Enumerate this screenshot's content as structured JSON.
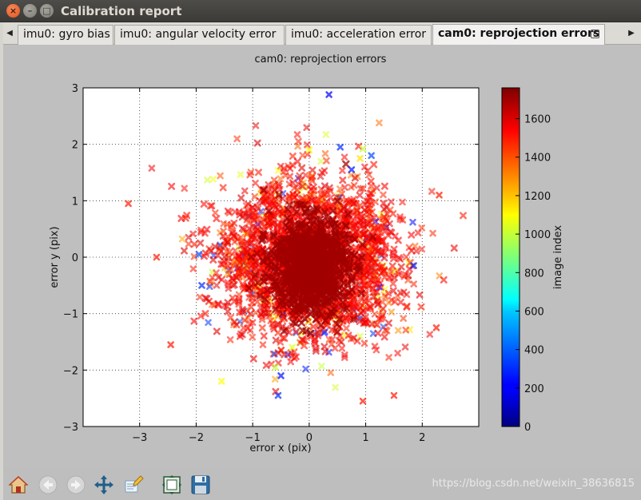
{
  "window": {
    "title": "Calibration report"
  },
  "tabs": [
    {
      "label": "imu0: gyro bias",
      "active": false
    },
    {
      "label": "imu0: angular velocity error",
      "active": false
    },
    {
      "label": "imu0: acceleration error",
      "active": false
    },
    {
      "label": "cam0: reprojection errors",
      "active": true
    }
  ],
  "toolbar": {
    "icons": [
      "home-icon",
      "back-arrow-icon",
      "forward-arrow-icon",
      "pan-icon",
      "zoom-to-rect-icon",
      "subplots-icon",
      "save-icon"
    ]
  },
  "watermark": "https://blog.csdn.net/weixin_38636815",
  "chart_data": {
    "type": "scatter",
    "title": "cam0: reprojection errors",
    "xlabel": "error x (pix)",
    "ylabel": "error y (pix)",
    "xlim": [
      -4,
      3
    ],
    "ylim": [
      -3,
      3
    ],
    "xticks": [
      "−3",
      "−2",
      "−1",
      "0",
      "1",
      "2"
    ],
    "xtick_values": [
      -3,
      -2,
      -1,
      0,
      1,
      2
    ],
    "yticks": [
      "3",
      "2",
      "1",
      "0",
      "−1",
      "−2",
      "−3"
    ],
    "ytick_values": [
      3,
      2,
      1,
      0,
      -1,
      -2,
      -3
    ],
    "grid": true,
    "marker": "x",
    "colormap": "jet",
    "colorbar": {
      "label": "image index",
      "range": [
        0,
        1760
      ],
      "ticks": [
        "0",
        "200",
        "400",
        "600",
        "800",
        "1000",
        "1200",
        "1400",
        "1600"
      ],
      "tick_values": [
        0,
        200,
        400,
        600,
        800,
        1000,
        1200,
        1400,
        1600
      ]
    },
    "cloud": {
      "center": [
        0.0,
        -0.05
      ],
      "dense_core": {
        "x_range": [
          -0.8,
          0.8
        ],
        "y_range": [
          -1.1,
          0.8
        ]
      },
      "extent": {
        "x_range": [
          -3.2,
          2.4
        ],
        "y_range": [
          -2.6,
          2.9
        ]
      },
      "dominant_index": 1700
    },
    "sample_points": [
      {
        "x": -3.2,
        "y": 0.95,
        "index": 1500
      },
      {
        "x": 0.35,
        "y": 2.88,
        "index": 200
      },
      {
        "x": -0.55,
        "y": -2.45,
        "index": 300
      },
      {
        "x": 0.95,
        "y": -2.55,
        "index": 1500
      },
      {
        "x": -2.45,
        "y": -1.55,
        "index": 1500
      },
      {
        "x": -2.7,
        "y": 0.0,
        "index": 1500
      },
      {
        "x": 1.5,
        "y": -2.45,
        "index": 1500
      },
      {
        "x": 2.3,
        "y": 1.1,
        "index": 1500
      },
      {
        "x": 2.25,
        "y": -1.25,
        "index": 1500
      },
      {
        "x": -1.55,
        "y": -2.2,
        "index": 1100
      },
      {
        "x": -0.3,
        "y": -1.6,
        "index": 1050
      },
      {
        "x": -0.6,
        "y": -1.95,
        "index": 1000
      },
      {
        "x": 0.95,
        "y": 1.92,
        "index": 1000
      },
      {
        "x": 0.55,
        "y": 1.95,
        "index": 300
      },
      {
        "x": 0.75,
        "y": 1.55,
        "index": 250
      },
      {
        "x": -0.5,
        "y": -2.1,
        "index": 250
      },
      {
        "x": -1.9,
        "y": -0.5,
        "index": 300
      },
      {
        "x": -1.95,
        "y": 0.05,
        "index": 350
      },
      {
        "x": 1.1,
        "y": 1.8,
        "index": 350
      },
      {
        "x": 1.85,
        "y": -0.15,
        "index": 300
      },
      {
        "x": 0.9,
        "y": 1.75,
        "index": 1150
      },
      {
        "x": 0.0,
        "y": 1.9,
        "index": 1100
      }
    ]
  }
}
